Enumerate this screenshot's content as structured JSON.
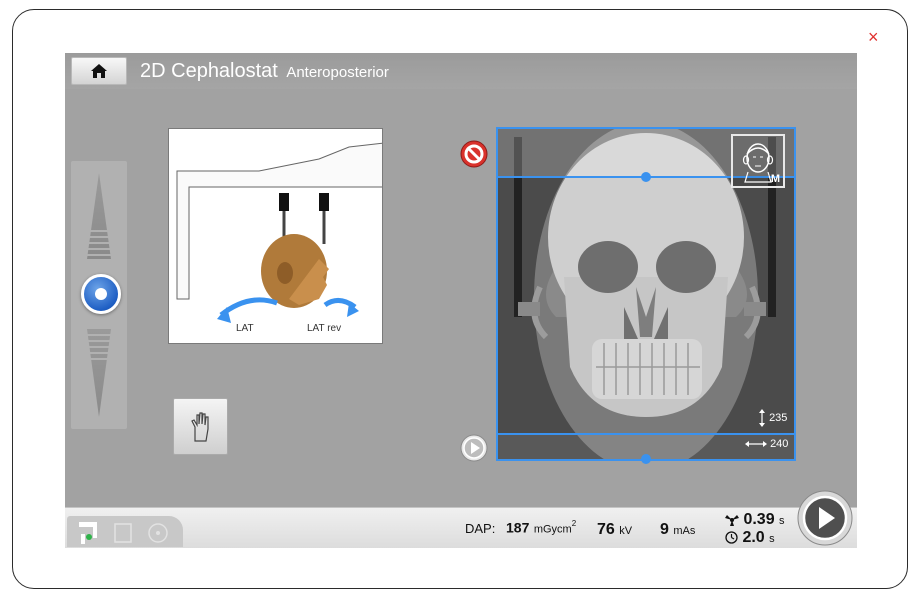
{
  "app": {
    "title_main": "2D Cephalostat",
    "title_sub": "Anteroposterior"
  },
  "icons": {
    "close": "×",
    "home": "home-icon",
    "hand": "hand-icon",
    "prohibited": "no-entry-icon",
    "play": "play-icon",
    "patient_face": "face-icon",
    "dose": "radiation-icon",
    "timer": "clock-icon"
  },
  "positioning": {
    "label_left": "LAT",
    "label_right": "LAT rev"
  },
  "image_area": {
    "face_label": "M",
    "height_value": "235",
    "width_value": "240"
  },
  "status": {
    "dap_label": "DAP:",
    "dap_value": "187",
    "dap_unit": "mGycm",
    "dap_unit_sup": "2",
    "kv_value": "76",
    "kv_unit": "kV",
    "mas_value": "9",
    "mas_unit": "mAs",
    "exposure_time": "0.39",
    "exposure_unit": "s",
    "scan_time": "2.0",
    "scan_unit": "s"
  },
  "colors": {
    "accent": "#3a92ef",
    "background": "#a2a2a2",
    "warning": "#d9322c"
  }
}
